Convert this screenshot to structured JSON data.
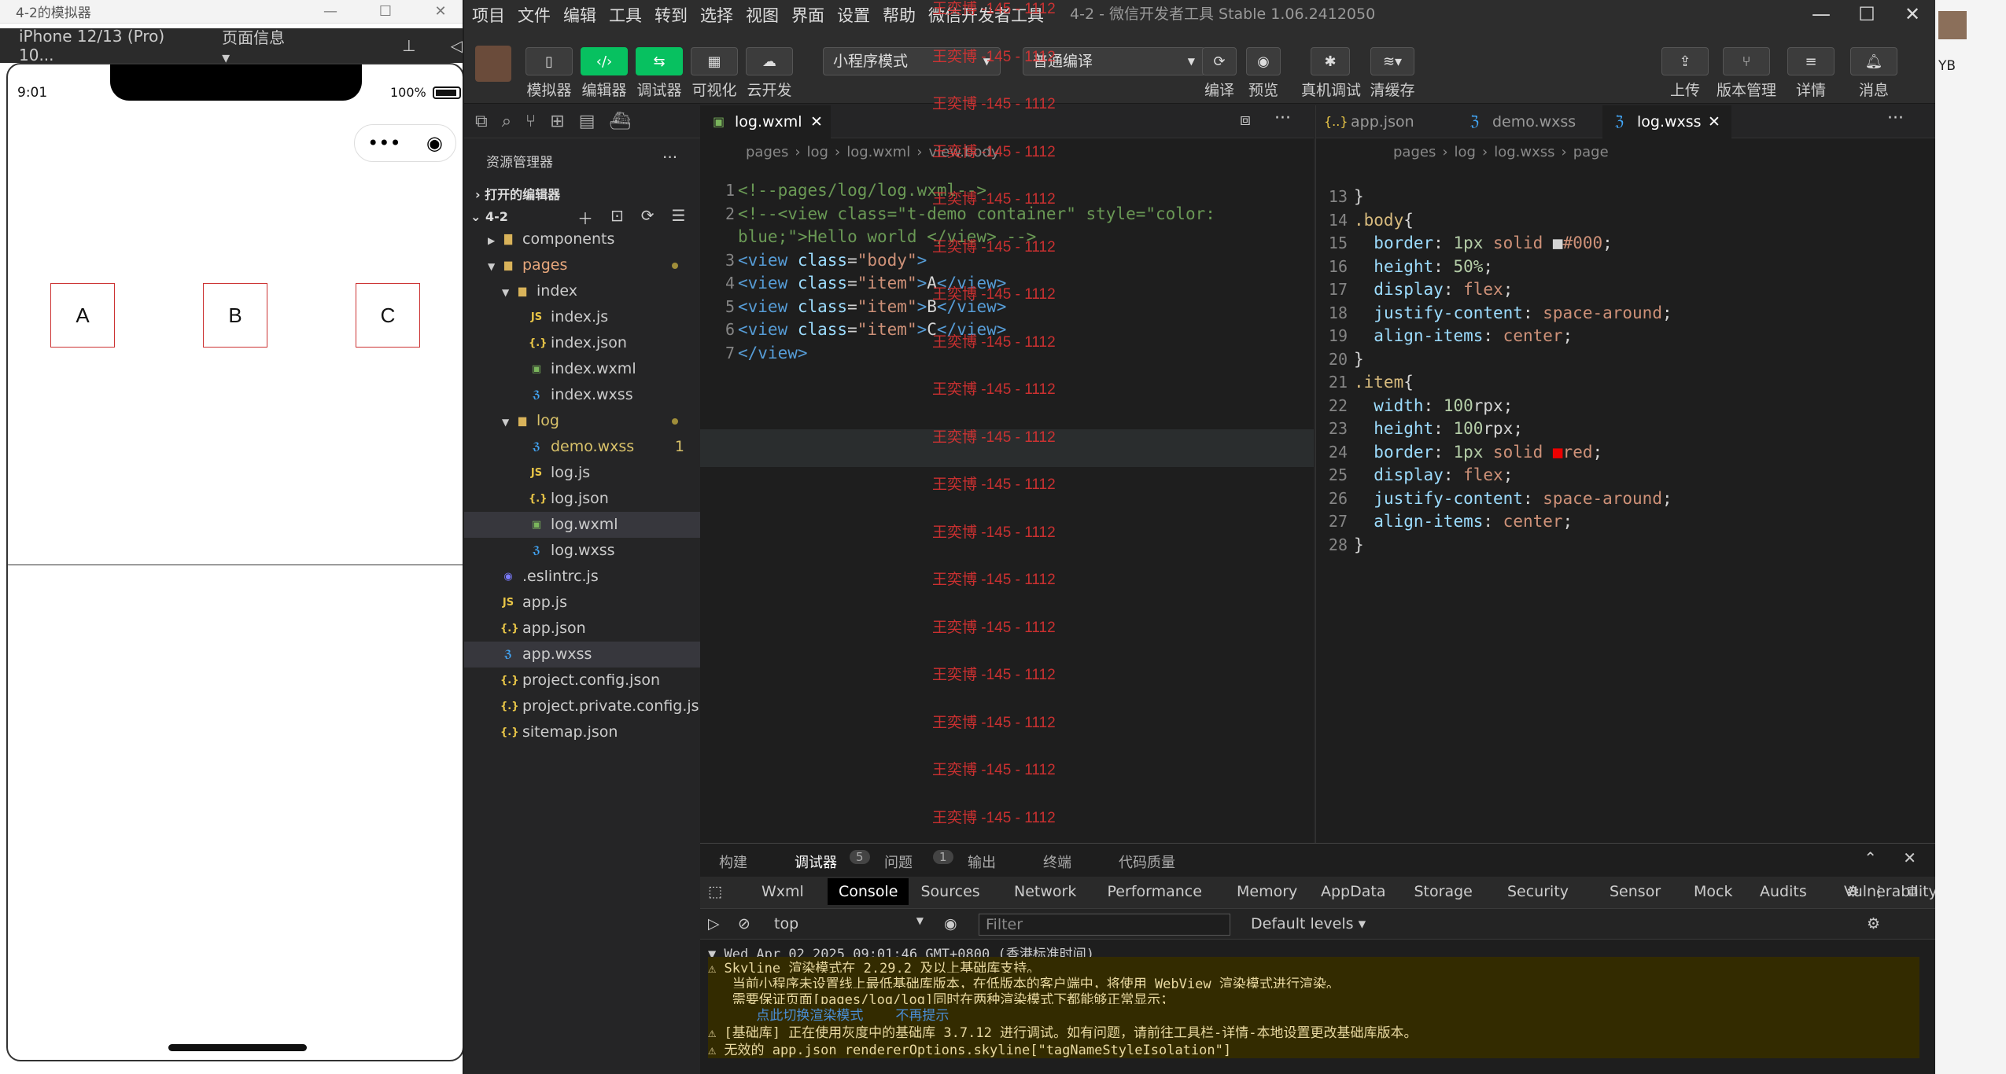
{
  "simulator": {
    "title": "4-2的模拟器",
    "device": "iPhone 12/13 (Pro) 10...",
    "page_info": "页面信息",
    "time": "9:01",
    "battery": "100%",
    "items": [
      "A",
      "B",
      "C"
    ]
  },
  "ide": {
    "menu": [
      "项目",
      "文件",
      "编辑",
      "工具",
      "转到",
      "选择",
      "视图",
      "界面",
      "设置",
      "帮助",
      "微信开发者工具"
    ],
    "window_title": "4-2 - 微信开发者工具 Stable 1.06.2412050",
    "toolbar": {
      "simulator": "模拟器",
      "editor": "编辑器",
      "debugger": "调试器",
      "visual": "可视化",
      "cloud": "云开发",
      "mode": "小程序模式",
      "compile_mode": "普通编译",
      "compile": "编译",
      "preview": "预览",
      "real_debug": "真机调试",
      "clear_cache": "清缓存",
      "upload": "上传",
      "version": "版本管理",
      "detail": "详情",
      "message": "消息"
    },
    "explorer": {
      "title": "资源管理器",
      "open_editors": "打开的编辑器",
      "project": "4-2",
      "tree": [
        {
          "name": "components",
          "type": "folder",
          "depth": 1
        },
        {
          "name": "pages",
          "type": "folder-open",
          "depth": 1,
          "dot": true,
          "color": "#e8a87c"
        },
        {
          "name": "index",
          "type": "folder-open",
          "depth": 2
        },
        {
          "name": "index.js",
          "type": "js",
          "depth": 3
        },
        {
          "name": "index.json",
          "type": "json",
          "depth": 3
        },
        {
          "name": "index.wxml",
          "type": "wxml",
          "depth": 3
        },
        {
          "name": "index.wxss",
          "type": "wxss",
          "depth": 3
        },
        {
          "name": "log",
          "type": "folder-open",
          "depth": 2,
          "dot": true,
          "color": "#d9c26a"
        },
        {
          "name": "demo.wxss",
          "type": "wxss",
          "depth": 3,
          "badge": "1",
          "color": "#d9c26a"
        },
        {
          "name": "log.js",
          "type": "js",
          "depth": 3
        },
        {
          "name": "log.json",
          "type": "json",
          "depth": 3
        },
        {
          "name": "log.wxml",
          "type": "wxml",
          "depth": 3,
          "selected": true
        },
        {
          "name": "log.wxss",
          "type": "wxss",
          "depth": 3
        },
        {
          "name": ".eslintrc.js",
          "type": "eslint",
          "depth": 1
        },
        {
          "name": "app.js",
          "type": "js",
          "depth": 1
        },
        {
          "name": "app.json",
          "type": "json",
          "depth": 1
        },
        {
          "name": "app.wxss",
          "type": "wxss",
          "depth": 1,
          "selected": true
        },
        {
          "name": "project.config.json",
          "type": "json",
          "depth": 1
        },
        {
          "name": "project.private.config.js...",
          "type": "json",
          "depth": 1
        },
        {
          "name": "sitemap.json",
          "type": "json",
          "depth": 1
        }
      ]
    },
    "editor1": {
      "tab": "log.wxml",
      "breadcrumb": [
        "pages",
        "log",
        "log.wxml",
        "view.body"
      ],
      "lines": [
        {
          "n": "1",
          "parts": [
            [
              "c-cm",
              "<!--pages/log/log.wxml-->"
            ]
          ]
        },
        {
          "n": "2",
          "parts": [
            [
              "c-cm",
              "<!--<view class=\"t-demo container\" style=\"color:"
            ]
          ]
        },
        {
          "n": "",
          "parts": [
            [
              "c-cm",
              "blue;\">Hello world </view> -->"
            ]
          ]
        },
        {
          "n": "3",
          "parts": [
            [
              "c-tag",
              "<view "
            ],
            [
              "c-attr",
              "class"
            ],
            [
              "c-txt",
              "="
            ],
            [
              "c-str",
              "\"body\""
            ],
            [
              "c-tag",
              ">"
            ]
          ]
        },
        {
          "n": "4",
          "parts": [
            [
              "c-tag",
              "<view "
            ],
            [
              "c-attr",
              "class"
            ],
            [
              "c-txt",
              "="
            ],
            [
              "c-str",
              "\"item\""
            ],
            [
              "c-tag",
              ">"
            ],
            [
              "c-txt",
              "A"
            ],
            [
              "c-tag",
              "</view>"
            ]
          ]
        },
        {
          "n": "5",
          "parts": [
            [
              "c-tag",
              "<view "
            ],
            [
              "c-attr",
              "class"
            ],
            [
              "c-txt",
              "="
            ],
            [
              "c-str",
              "\"item\""
            ],
            [
              "c-tag",
              ">"
            ],
            [
              "c-txt",
              "B"
            ],
            [
              "c-tag",
              "</view>"
            ]
          ]
        },
        {
          "n": "6",
          "parts": [
            [
              "c-tag",
              "<view "
            ],
            [
              "c-attr",
              "class"
            ],
            [
              "c-txt",
              "="
            ],
            [
              "c-str",
              "\"item\""
            ],
            [
              "c-tag",
              ">"
            ],
            [
              "c-txt",
              "C"
            ],
            [
              "c-tag",
              "</view>"
            ]
          ]
        },
        {
          "n": "7",
          "parts": [
            [
              "c-tag",
              "</view>"
            ]
          ]
        }
      ]
    },
    "editor2": {
      "tabs": [
        "app.json",
        "demo.wxss",
        "log.wxss"
      ],
      "breadcrumb": [
        "pages",
        "log",
        "log.wxss",
        "page"
      ],
      "lines": [
        {
          "n": "13",
          "parts": [
            [
              "c-pl",
              "}"
            ]
          ]
        },
        {
          "n": "14",
          "parts": [
            [
              "c-sel",
              ".body"
            ],
            [
              "c-pl",
              "{"
            ]
          ]
        },
        {
          "n": "15",
          "parts": [
            [
              "c-pl",
              "  "
            ],
            [
              "c-prop",
              "border"
            ],
            [
              "c-pl",
              ": "
            ],
            [
              "c-num",
              "1px"
            ],
            [
              "c-val",
              " solid "
            ],
            [
              "c-pl",
              "■"
            ],
            [
              "c-val",
              "#000"
            ],
            [
              "c-pl",
              ";"
            ]
          ]
        },
        {
          "n": "16",
          "parts": [
            [
              "c-pl",
              "  "
            ],
            [
              "c-prop",
              "height"
            ],
            [
              "c-pl",
              ": "
            ],
            [
              "c-num",
              "50%"
            ],
            [
              "c-pl",
              ";"
            ]
          ]
        },
        {
          "n": "17",
          "parts": [
            [
              "c-pl",
              "  "
            ],
            [
              "c-prop",
              "display"
            ],
            [
              "c-pl",
              ": "
            ],
            [
              "c-val",
              "flex"
            ],
            [
              "c-pl",
              ";"
            ]
          ]
        },
        {
          "n": "18",
          "parts": [
            [
              "c-pl",
              "  "
            ],
            [
              "c-prop",
              "justify-content"
            ],
            [
              "c-pl",
              ": "
            ],
            [
              "c-val",
              "space-around"
            ],
            [
              "c-pl",
              ";"
            ]
          ]
        },
        {
          "n": "19",
          "parts": [
            [
              "c-pl",
              "  "
            ],
            [
              "c-prop",
              "align-items"
            ],
            [
              "c-pl",
              ": "
            ],
            [
              "c-val",
              "center"
            ],
            [
              "c-pl",
              ";"
            ]
          ]
        },
        {
          "n": "20",
          "parts": [
            [
              "c-pl",
              "}"
            ]
          ]
        },
        {
          "n": "21",
          "parts": [
            [
              "c-sel",
              ".item"
            ],
            [
              "c-pl",
              "{"
            ]
          ]
        },
        {
          "n": "22",
          "parts": [
            [
              "c-pl",
              "  "
            ],
            [
              "c-prop",
              "width"
            ],
            [
              "c-pl",
              ": "
            ],
            [
              "c-num",
              "100"
            ],
            [
              "c-pl",
              "rpx;"
            ]
          ]
        },
        {
          "n": "23",
          "parts": [
            [
              "c-pl",
              "  "
            ],
            [
              "c-prop",
              "height"
            ],
            [
              "c-pl",
              ": "
            ],
            [
              "c-num",
              "100"
            ],
            [
              "c-pl",
              "rpx;"
            ]
          ]
        },
        {
          "n": "24",
          "parts": [
            [
              "c-pl",
              "  "
            ],
            [
              "c-prop",
              "border"
            ],
            [
              "c-pl",
              ": "
            ],
            [
              "c-num",
              "1px"
            ],
            [
              "c-val",
              " solid "
            ],
            [
              "c-red",
              "■"
            ],
            [
              "c-val",
              "red"
            ],
            [
              "c-pl",
              ";"
            ]
          ]
        },
        {
          "n": "25",
          "parts": [
            [
              "c-pl",
              "  "
            ],
            [
              "c-prop",
              "display"
            ],
            [
              "c-pl",
              ": "
            ],
            [
              "c-val",
              "flex"
            ],
            [
              "c-pl",
              ";"
            ]
          ]
        },
        {
          "n": "26",
          "parts": [
            [
              "c-pl",
              "  "
            ],
            [
              "c-prop",
              "justify-content"
            ],
            [
              "c-pl",
              ": "
            ],
            [
              "c-val",
              "space-around"
            ],
            [
              "c-pl",
              ";"
            ]
          ]
        },
        {
          "n": "27",
          "parts": [
            [
              "c-pl",
              "  "
            ],
            [
              "c-prop",
              "align-items"
            ],
            [
              "c-pl",
              ": "
            ],
            [
              "c-val",
              "center"
            ],
            [
              "c-pl",
              ";"
            ]
          ]
        },
        {
          "n": "28",
          "parts": [
            [
              "c-pl",
              "}"
            ]
          ]
        }
      ]
    },
    "watermark": "王奕博 -145 - 1112",
    "panel": {
      "tabs": [
        "构建",
        "调试器",
        "问题",
        "输出",
        "终端",
        "代码质量"
      ],
      "debugger_count": "5",
      "problems_count": "1",
      "devtabs": [
        "Wxml",
        "Console",
        "Sources",
        "Network",
        "Performance",
        "Memory",
        "AppData",
        "Storage",
        "Security",
        "Sensor",
        "Mock",
        "Audits",
        "Vulnerability"
      ],
      "warn_count": "5",
      "context": "top",
      "filter_placeholder": "Filter",
      "levels": "Default levels",
      "logs": [
        "▼ Wed Apr 02 2025 09:01:46 GMT+0800 (香港标准时间)",
        "⚠ Skyline 渲染模式在 2.29.2 及以上基础库支持。",
        "   当前小程序未设置线上最低基础库版本，在低版本的客户端中，将使用 WebView 渲染模式进行渲染。",
        "   需要保证页面[pages/log/log]同时在两种渲染模式下都能够正常显示；",
        "      点此切换渲染模式    不再提示",
        "⚠ [基础库] 正在使用灰度中的基础库 3.7.12 进行调试。如有问题，请前往工具栏-详情-本地设置更改基础库版本。",
        "⚠ 无效的 app.json rendererOptions.skyline[\"tagNameStyleIsolation\"]"
      ]
    }
  },
  "strip": {
    "label": "YB"
  }
}
